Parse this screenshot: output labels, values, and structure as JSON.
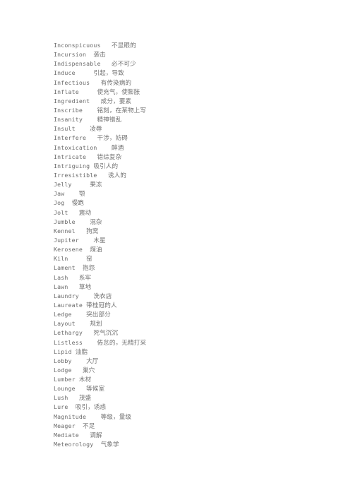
{
  "document": {
    "type": "scanned-vocabulary-list",
    "background_color": "#ffffff",
    "text_color": "#6d6d6d",
    "entries": [
      {
        "term": "Inconspicuous",
        "gap": 3,
        "gloss": "不显眼的"
      },
      {
        "term": "Incursion",
        "gap": 2,
        "gloss": "袭击"
      },
      {
        "term": "Indispensable",
        "gap": 3,
        "gloss": "必不可少"
      },
      {
        "term": "Induce",
        "gap": 5,
        "gloss": "引起，导致"
      },
      {
        "term": "Infectious",
        "gap": 3,
        "gloss": "有传染病的"
      },
      {
        "term": "Inflate",
        "gap": 5,
        "gloss": "使充气，使膨胀"
      },
      {
        "term": "Ingredient",
        "gap": 3,
        "gloss": "成分，要素"
      },
      {
        "term": "Inscribe",
        "gap": 4,
        "gloss": "铭刻，在某物上写"
      },
      {
        "term": "Insanity",
        "gap": 4,
        "gloss": "精神错乱"
      },
      {
        "term": "Insult",
        "gap": 4,
        "gloss": "凌辱"
      },
      {
        "term": "Interfere",
        "gap": 3,
        "gloss": "干涉，妨碍"
      },
      {
        "term": "Intoxication",
        "gap": 4,
        "gloss": "醉酒"
      },
      {
        "term": "Intricate",
        "gap": 3,
        "gloss": "错综复杂"
      },
      {
        "term": "Intriguing",
        "gap": 1,
        "gloss": "吸引人的"
      },
      {
        "term": "Irresistible",
        "gap": 3,
        "gloss": "诱人的"
      },
      {
        "term": "Jelly",
        "gap": 5,
        "gloss": "果冻"
      },
      {
        "term": "Jaw",
        "gap": 4,
        "gloss": "颚"
      },
      {
        "term": "Jog",
        "gap": 2,
        "gloss": "慢跑"
      },
      {
        "term": "Jolt",
        "gap": 3,
        "gloss": "震动"
      },
      {
        "term": "Jumble",
        "gap": 4,
        "gloss": "混杂"
      },
      {
        "term": "Kennel",
        "gap": 3,
        "gloss": "狗窝"
      },
      {
        "term": "Jupiter",
        "gap": 4,
        "gloss": "木星"
      },
      {
        "term": "Kerosene",
        "gap": 2,
        "gloss": "煤油"
      },
      {
        "term": "Kiln",
        "gap": 5,
        "gloss": "窑"
      },
      {
        "term": "Lament",
        "gap": 2,
        "gloss": "抱怨"
      },
      {
        "term": "Lash",
        "gap": 3,
        "gloss": "系牢"
      },
      {
        "term": "Lawn",
        "gap": 3,
        "gloss": "草地"
      },
      {
        "term": "Laundry",
        "gap": 4,
        "gloss": "洗衣店"
      },
      {
        "term": "Laureate",
        "gap": 1,
        "gloss": "带桂冠的人"
      },
      {
        "term": "Ledge",
        "gap": 4,
        "gloss": "突出部分"
      },
      {
        "term": "Layout",
        "gap": 4,
        "gloss": "规划"
      },
      {
        "term": "Lethargy",
        "gap": 3,
        "gloss": "死气沉沉"
      },
      {
        "term": "Listless",
        "gap": 4,
        "gloss": "倦怠的，无精打采"
      },
      {
        "term": "Lipid",
        "gap": 1,
        "gloss": "油脂"
      },
      {
        "term": "Lobby",
        "gap": 4,
        "gloss": "大厅"
      },
      {
        "term": "Lodge",
        "gap": 3,
        "gloss": "巢穴"
      },
      {
        "term": "Lumber",
        "gap": 1,
        "gloss": "木材"
      },
      {
        "term": "Lounge",
        "gap": 3,
        "gloss": "等候室"
      },
      {
        "term": "Lush",
        "gap": 3,
        "gloss": "茂盛"
      },
      {
        "term": "Lure",
        "gap": 2,
        "gloss": "吸引，诱惑"
      },
      {
        "term": "Magnitude",
        "gap": 4,
        "gloss": "等级，量级"
      },
      {
        "term": "Meager",
        "gap": 2,
        "gloss": "不足"
      },
      {
        "term": "Mediate",
        "gap": 3,
        "gloss": "调解"
      },
      {
        "term": "Meteorology",
        "gap": 2,
        "gloss": "气象学"
      }
    ]
  }
}
